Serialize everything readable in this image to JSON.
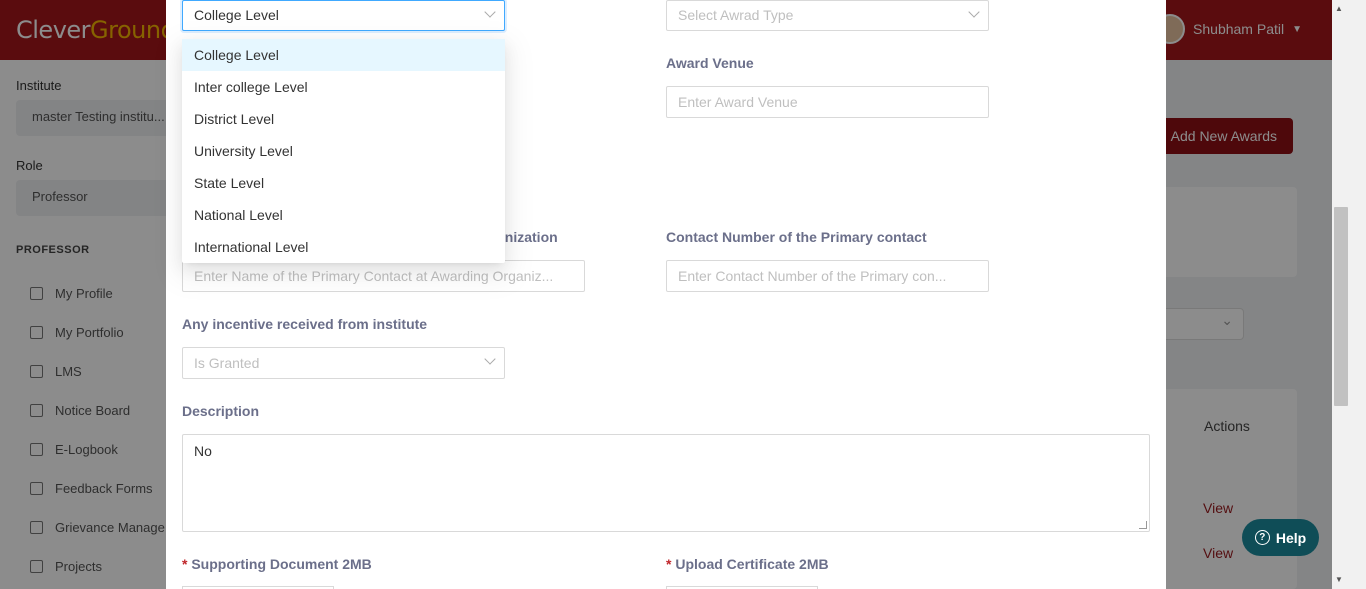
{
  "header": {
    "logo_part1": "Clever",
    "logo_part2": "Ground",
    "user_name": "Shubham Patil"
  },
  "sidebar": {
    "institute_label": "Institute",
    "institute_value": "master Testing institu...",
    "role_label": "Role",
    "role_value": "Professor",
    "section_title": "PROFESSOR",
    "items": [
      {
        "label": "My Profile",
        "icon": "user-icon"
      },
      {
        "label": "My Portfolio",
        "icon": "trophy-icon"
      },
      {
        "label": "LMS",
        "icon": "chart-line-icon"
      },
      {
        "label": "Notice Board",
        "icon": "calendar-icon"
      },
      {
        "label": "E-Logbook",
        "icon": "book-icon"
      },
      {
        "label": "Feedback Forms",
        "icon": "book-icon"
      },
      {
        "label": "Grievance Manage",
        "icon": "user-icon"
      },
      {
        "label": "Projects",
        "icon": "book-icon"
      }
    ]
  },
  "main": {
    "add_button": "Add New Awards",
    "actions_header": "Actions",
    "view_links": [
      "View",
      "View"
    ]
  },
  "modal": {
    "award_level": {
      "value": "College Level"
    },
    "award_type": {
      "placeholder": "Select Awrad Type"
    },
    "award_venue": {
      "label": "Award Venue",
      "placeholder": "Enter Award Venue"
    },
    "primary_contact_name": {
      "label": "Name of the Primary Contact at Awarding Organization",
      "visible_label": "anization",
      "placeholder": "Enter Name of the Primary Contact at Awarding Organiz..."
    },
    "primary_contact_number": {
      "label": "Contact Number of the Primary contact",
      "placeholder": "Enter Contact Number of the Primary con..."
    },
    "incentive": {
      "label": "Any incentive received from institute",
      "placeholder": "Is Granted"
    },
    "description": {
      "label": "Description",
      "value": "No"
    },
    "supporting_doc": {
      "required_mark": "*",
      "label": "Supporting Document 2MB"
    },
    "certificate": {
      "required_mark": "*",
      "label": "Upload Certificate 2MB"
    }
  },
  "dropdown": {
    "options": [
      "College Level",
      "Inter college Level",
      "District Level",
      "University Level",
      "State Level",
      "National Level",
      "International Level"
    ],
    "selected_index": 0
  },
  "help": {
    "label": "Help"
  }
}
